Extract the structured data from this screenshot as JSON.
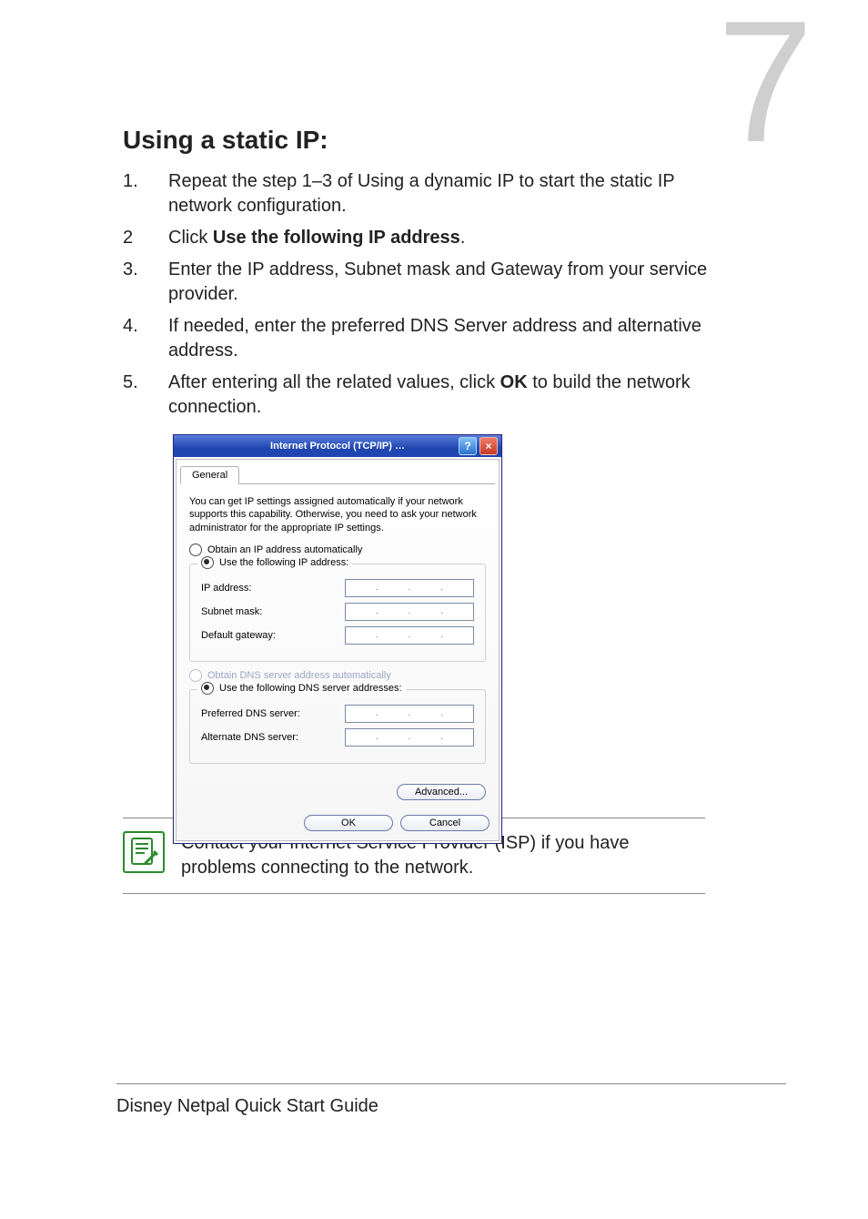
{
  "chapter_number": "7",
  "heading": "Using a static IP:",
  "steps": [
    {
      "n": "1.",
      "parts": [
        "Repeat the step 1–3 of Using a dynamic IP to start the static IP network configuration."
      ]
    },
    {
      "n": "2",
      "parts": [
        "Click ",
        {
          "b": "Use the following IP address"
        },
        "."
      ]
    },
    {
      "n": "3.",
      "parts": [
        "Enter the IP address, Subnet mask and Gateway from your service provider."
      ]
    },
    {
      "n": "4.",
      "parts": [
        "If needed, enter the preferred DNS Server address and alternative address."
      ]
    },
    {
      "n": "5.",
      "parts": [
        "After entering all the related values, click ",
        {
          "b": "OK"
        },
        " to build the network connection."
      ]
    }
  ],
  "dialog": {
    "title": "Internet Protocol (TCP/IP) …",
    "help_glyph": "?",
    "close_glyph": "×",
    "tab": "General",
    "intro": "You can get IP settings assigned automatically if your network supports this capability. Otherwise, you need to ask your network administrator for the appropriate IP settings.",
    "ip_auto": "Obtain an IP address automatically",
    "ip_manual": "Use the following IP address:",
    "ip_label": "IP address:",
    "subnet_label": "Subnet mask:",
    "gateway_label": "Default gateway:",
    "dns_auto": "Obtain DNS server address automatically",
    "dns_manual": "Use the following DNS server addresses:",
    "pref_dns": "Preferred DNS server:",
    "alt_dns": "Alternate DNS server:",
    "advanced": "Advanced...",
    "ok": "OK",
    "cancel": "Cancel",
    "dot": "."
  },
  "note": "Contact your Internet Service Provider (ISP) if you have problems connecting to the network.",
  "footer": "Disney Netpal Quick Start Guide"
}
